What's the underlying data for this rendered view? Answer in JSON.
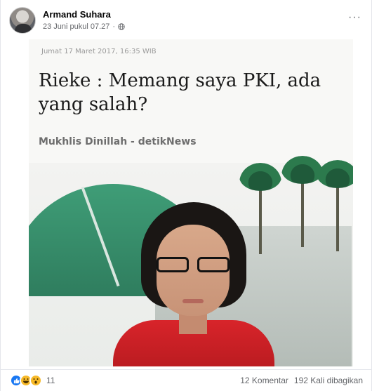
{
  "post": {
    "author": "Armand Suhara",
    "timestamp": "23 Juni pukul 07.27",
    "separator": "·",
    "privacy_icon": "globe-icon",
    "more_label": "···"
  },
  "image": {
    "news_date": "Jumat 17 Maret 2017, 16:35 WIB",
    "headline": "Rieke : Memang saya PKI, ada yang salah?",
    "byline": "Mukhlis Dinillah - detikNews"
  },
  "footer": {
    "reactions": [
      "like",
      "haha",
      "wow"
    ],
    "reaction_count": "11",
    "comments": "12 Komentar",
    "shares": "192 Kali dibagikan"
  },
  "colors": {
    "like": "#1877f2",
    "emoji": "#f7b928",
    "meta_text": "#65676b",
    "shirt": "#d8242a"
  }
}
